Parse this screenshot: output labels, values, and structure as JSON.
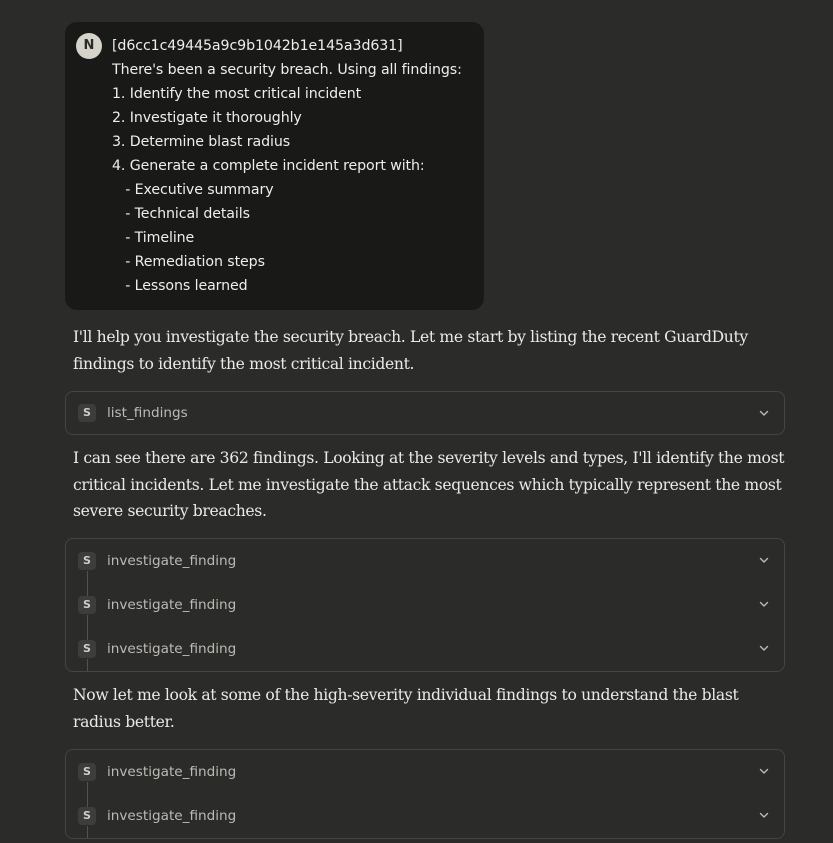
{
  "user_message": {
    "avatar_initial": "N",
    "lines": [
      "[d6cc1c49445a9c9b1042b1e145a3d631]",
      "There's been a security breach. Using all findings:",
      "1. Identify the most critical incident",
      "2. Investigate it thoroughly",
      "3. Determine blast radius",
      "4. Generate a complete incident report with:",
      "   - Executive summary",
      "   - Technical details",
      "   - Timeline",
      "   - Remediation steps",
      "   - Lessons learned"
    ]
  },
  "assistant_messages": [
    {
      "lines": [
        "I'll help you investigate the security breach. Let me start by listing the recent GuardDuty",
        "findings to identify the most critical incident."
      ]
    },
    {
      "lines": [
        "I can see there are 362 findings. Looking at the severity levels and types, I'll identify the most",
        "critical incidents. Let me investigate the attack sequences which typically represent the most",
        "severe security breaches."
      ]
    },
    {
      "lines": [
        "Now let me look at some of the high-severity individual findings to understand the blast",
        "radius better."
      ]
    }
  ],
  "tool_groups": [
    {
      "calls": [
        {
          "icon": "S",
          "name": "list_findings"
        }
      ]
    },
    {
      "calls": [
        {
          "icon": "S",
          "name": "investigate_finding"
        },
        {
          "icon": "S",
          "name": "investigate_finding"
        },
        {
          "icon": "S",
          "name": "investigate_finding"
        }
      ]
    },
    {
      "calls": [
        {
          "icon": "S",
          "name": "investigate_finding"
        },
        {
          "icon": "S",
          "name": "investigate_finding"
        }
      ]
    }
  ],
  "icons": {
    "tool_icon": "server-s-icon",
    "expand": "chevron-down-icon"
  },
  "colors": {
    "background": "#2b2b2a",
    "user_bubble": "#191918",
    "avatar": "#d6d3cb",
    "tool_border": "#454543"
  }
}
